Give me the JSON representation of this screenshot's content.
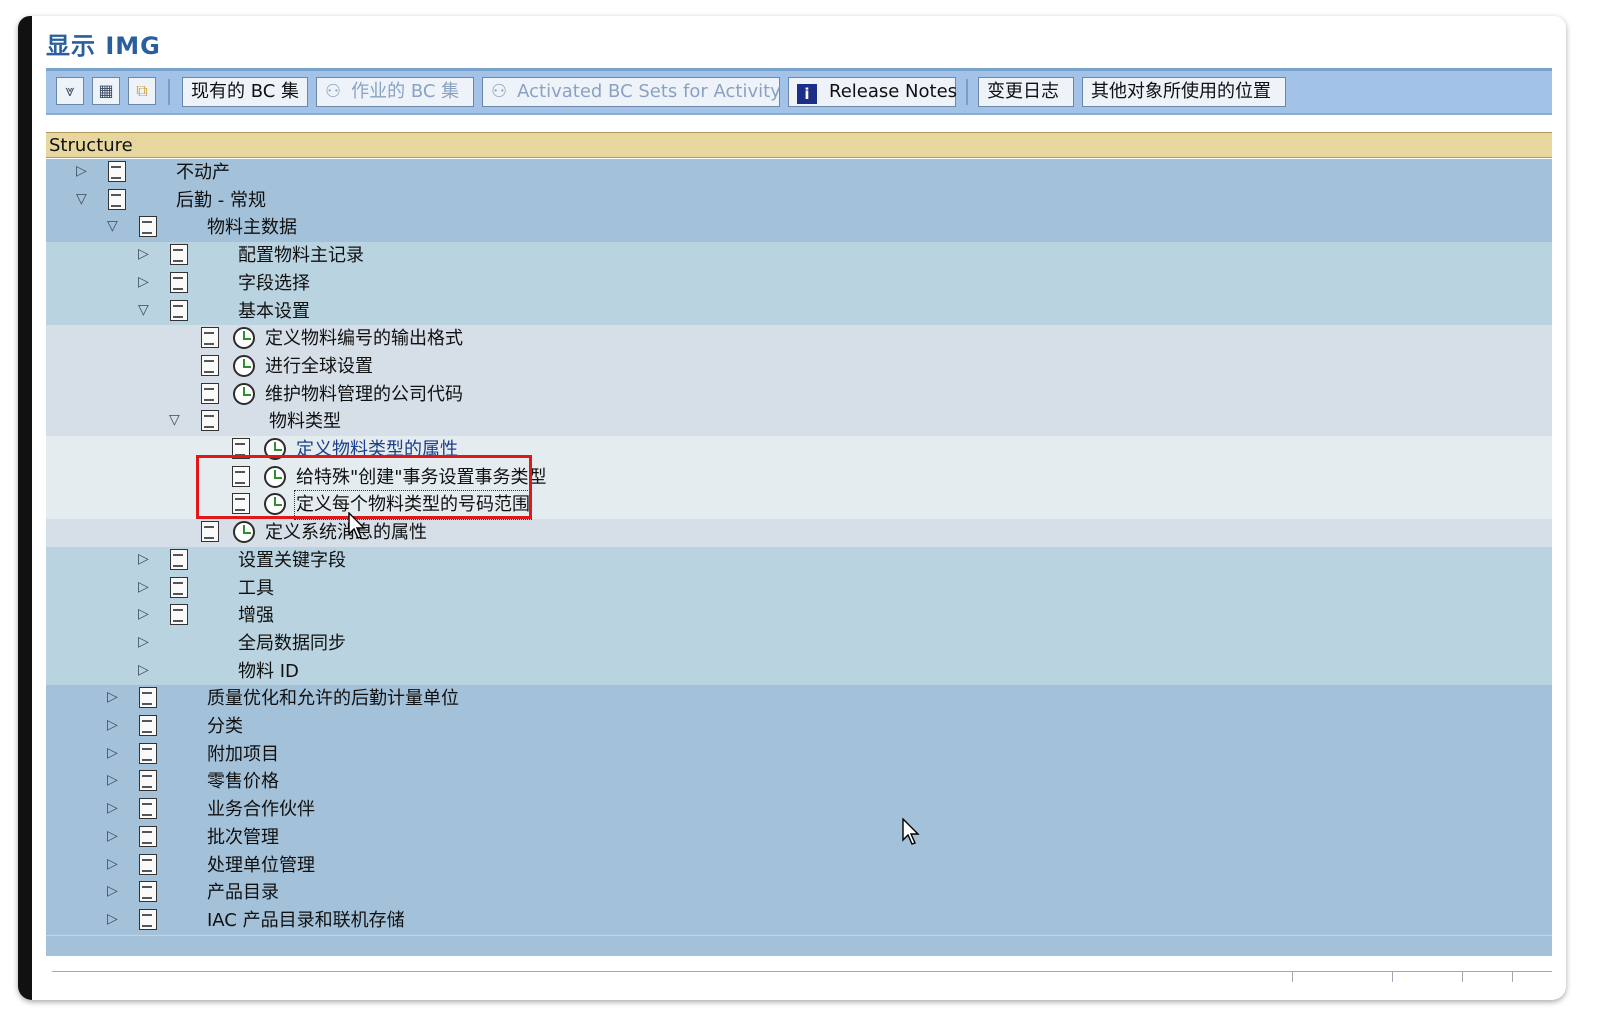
{
  "window": {
    "title": "显示 IMG"
  },
  "toolbar": {
    "icons": [
      "expand-subtree-icon",
      "select-icon",
      "copy-icon"
    ],
    "btn_existing_bc": "现有的 BC 集",
    "btn_activity_bc": "作业的 BC 集",
    "btn_activated_bc": "Activated BC Sets for Activity",
    "btn_release_notes": "Release Notes",
    "btn_change_log": "变更日志",
    "btn_where_used": "其他对象所使用的位置"
  },
  "structure_header": "Structure",
  "tree": {
    "items": [
      {
        "label": "不动产",
        "state": "collapsed"
      },
      {
        "label": "后勤 - 常规",
        "state": "expanded"
      },
      {
        "label": "物料主数据",
        "state": "expanded"
      },
      {
        "label": "配置物料主记录",
        "state": "collapsed"
      },
      {
        "label": "字段选择",
        "state": "collapsed"
      },
      {
        "label": "基本设置",
        "state": "expanded"
      },
      {
        "label": "定义物料编号的输出格式",
        "state": "activity"
      },
      {
        "label": "进行全球设置",
        "state": "activity"
      },
      {
        "label": "维护物料管理的公司代码",
        "state": "activity"
      },
      {
        "label": "物料类型",
        "state": "expanded"
      },
      {
        "label": "定义物料类型的属性",
        "state": "activity"
      },
      {
        "label": "给特殊\"创建\"事务设置事务类型",
        "state": "activity"
      },
      {
        "label": "定义每个物料类型的号码范围",
        "state": "activity-selected"
      },
      {
        "label": "定义系统消息的属性",
        "state": "activity"
      },
      {
        "label": "设置关键字段",
        "state": "collapsed"
      },
      {
        "label": "工具",
        "state": "collapsed"
      },
      {
        "label": "增强",
        "state": "collapsed"
      },
      {
        "label": "全局数据同步",
        "state": "collapsed"
      },
      {
        "label": "物料 ID",
        "state": "collapsed"
      },
      {
        "label": "质量优化和允许的后勤计量单位",
        "state": "collapsed"
      },
      {
        "label": "分类",
        "state": "collapsed"
      },
      {
        "label": "附加项目",
        "state": "collapsed"
      },
      {
        "label": "零售价格",
        "state": "collapsed"
      },
      {
        "label": "业务合作伙伴",
        "state": "collapsed"
      },
      {
        "label": "批次管理",
        "state": "collapsed"
      },
      {
        "label": "处理单位管理",
        "state": "collapsed"
      },
      {
        "label": "产品目录",
        "state": "collapsed"
      },
      {
        "label": "IAC 产品目录和联机存储",
        "state": "collapsed"
      }
    ]
  },
  "colors": {
    "title": "#2a5f9e",
    "toolbar": "#a3c2e8",
    "structure_header": "#e7d79e",
    "tree_level1": "#a3c1d8",
    "tree_level2": "#b9d3e0",
    "tree_level3": "#d6dfe8",
    "tree_level4": "#e5ecf0",
    "highlight_box": "#e01818"
  }
}
